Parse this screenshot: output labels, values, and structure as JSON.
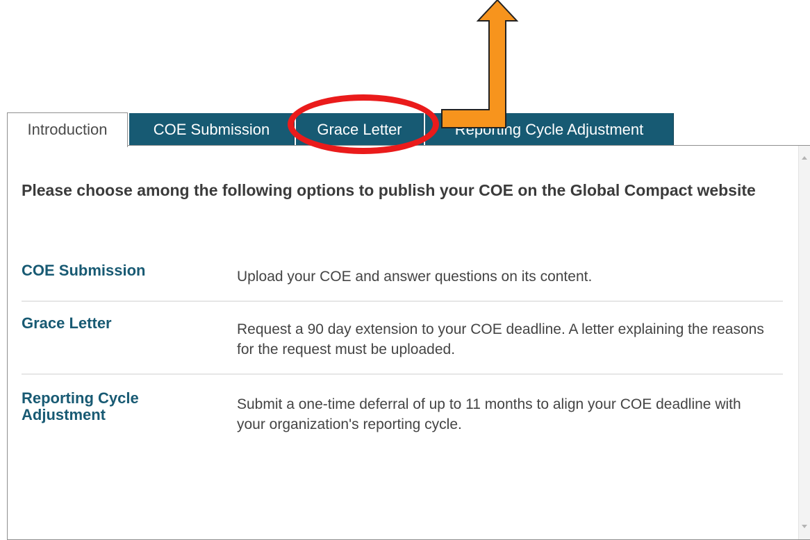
{
  "tabs": [
    {
      "label": "Introduction",
      "active": true
    },
    {
      "label": "COE Submission",
      "active": false
    },
    {
      "label": "Grace Letter",
      "active": false
    },
    {
      "label": "Reporting Cycle Adjustment",
      "active": false
    }
  ],
  "panel": {
    "heading": "Please choose among the following options to publish your COE on the Global Compact website",
    "options": [
      {
        "name": "COE Submission",
        "description": "Upload your COE and answer questions on its content."
      },
      {
        "name": "Grace Letter",
        "description": "Request a 90 day extension to your COE deadline. A letter explaining the reasons for the request must be uploaded."
      },
      {
        "name": "Reporting Cycle Adjustment",
        "description": "Submit a one-time deferral of up to 11 months to align your COE deadline with your organization's reporting cycle."
      }
    ]
  },
  "colors": {
    "tab_dark": "#175a73",
    "link_text": "#185a73",
    "annotation_ellipse": "#ea1b1b",
    "annotation_arrow": "#f7941d"
  },
  "annotations": {
    "ellipse_target": "Grace Letter",
    "arrow_direction": "up"
  }
}
